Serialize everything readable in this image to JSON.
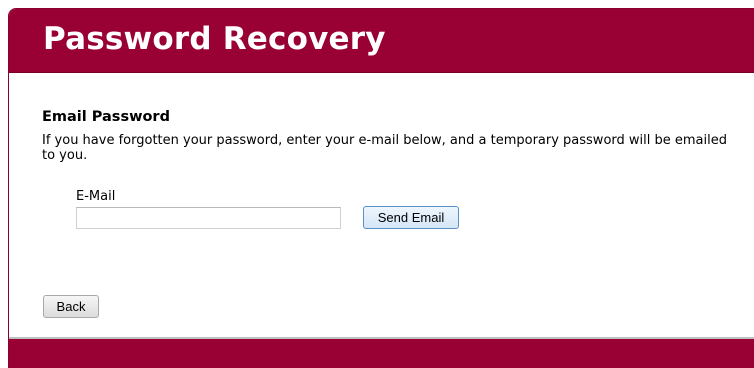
{
  "header": {
    "title": "Password Recovery"
  },
  "section": {
    "title": "Email Password",
    "description": "If you have forgotten your password, enter your e-mail below, and a temporary password will be emailed to you."
  },
  "form": {
    "email_label": "E-Mail",
    "email_value": "",
    "send_button_label": "Send Email"
  },
  "nav": {
    "back_button_label": "Back"
  },
  "colors": {
    "brand": "#990033"
  }
}
